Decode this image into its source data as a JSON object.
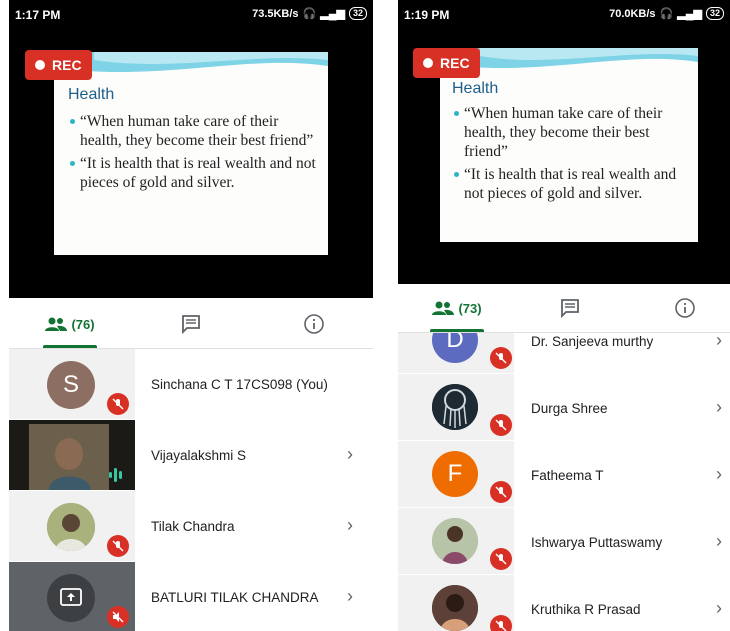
{
  "left": {
    "status": {
      "time": "1:17 PM",
      "network_speed": "73.5KB/s",
      "battery": "32"
    },
    "rec_label": "REC",
    "slide": {
      "title": "Health",
      "bullets": [
        "“When human take care of their health, they become their best friend”",
        "“It is health that is real wealth and not pieces of gold and silver."
      ]
    },
    "tabs": {
      "people_count": "(76)",
      "people_icon": "people-icon",
      "chat_icon": "chat-icon",
      "info_icon": "info-icon"
    },
    "participants": [
      {
        "name": "Sinchana C T 17CS098 (You)",
        "initial": "S",
        "avatar_color": "#8d6e63",
        "muted": true,
        "chevron": false
      },
      {
        "name": "Vijayalakshmi S",
        "camera": true,
        "speaking": true,
        "chevron": true
      },
      {
        "name": "Tilak Chandra",
        "photo": true,
        "muted": true,
        "chevron": true
      },
      {
        "name": "BATLURI TILAK CHANDRA",
        "presenting": true,
        "muted": true,
        "chevron": true
      }
    ]
  },
  "right": {
    "status": {
      "time": "1:19 PM",
      "network_speed": "70.0KB/s",
      "battery": "32"
    },
    "rec_label": "REC",
    "slide": {
      "title": "Health",
      "bullets": [
        "“When human take care of their health, they become their best friend”",
        "“It is health that is real wealth and not pieces of gold and silver."
      ]
    },
    "tabs": {
      "people_count": "(73)",
      "people_icon": "people-icon",
      "chat_icon": "chat-icon",
      "info_icon": "info-icon"
    },
    "participants": [
      {
        "name": "Dr. Sanjeeva murthy",
        "initial": "D",
        "avatar_color": "#5c6bc0",
        "muted": true,
        "chevron": true
      },
      {
        "name": "Durga Shree",
        "photo": true,
        "muted": true,
        "chevron": true
      },
      {
        "name": "Fatheema T",
        "initial": "F",
        "avatar_color": "#ef6c00",
        "muted": true,
        "chevron": true
      },
      {
        "name": "Ishwarya Puttaswamy",
        "photo": true,
        "muted": true,
        "chevron": true
      },
      {
        "name": "Kruthika R Prasad",
        "photo": true,
        "muted": true,
        "chevron": true
      }
    ]
  },
  "colors": {
    "accent": "#137333",
    "rec": "#d93025",
    "mute": "#d93025"
  }
}
